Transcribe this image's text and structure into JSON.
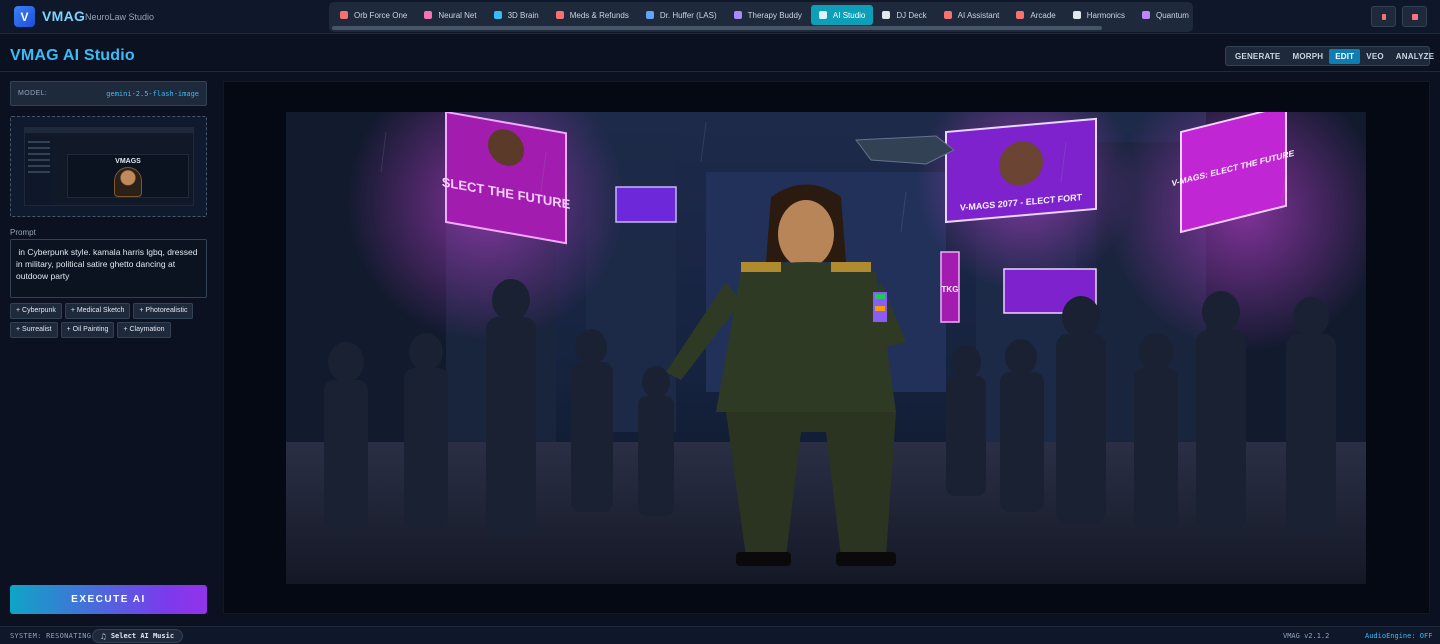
{
  "app": {
    "logo_letter": "V",
    "name": "VMAG",
    "subtitle": "NeuroLaw Studio"
  },
  "nav": {
    "items": [
      {
        "label": "Orb Force One",
        "icon": "orb-icon",
        "color": "#f87171"
      },
      {
        "label": "Neural Net",
        "icon": "brain-icon",
        "color": "#f472b6"
      },
      {
        "label": "3D Brain",
        "icon": "cube-icon",
        "color": "#38bdf8"
      },
      {
        "label": "Meds & Refunds",
        "icon": "pill-icon",
        "color": "#f87171"
      },
      {
        "label": "Dr. Huffer (LAS)",
        "icon": "shield-icon",
        "color": "#60a5fa"
      },
      {
        "label": "Therapy Buddy",
        "icon": "chat-icon",
        "color": "#a78bfa"
      },
      {
        "label": "AI Studio",
        "icon": "palette-icon",
        "color": "#e0f2fe",
        "active": true
      },
      {
        "label": "DJ Deck",
        "icon": "headphones-icon",
        "color": "#e2e8f0"
      },
      {
        "label": "AI Assistant",
        "icon": "robot-icon",
        "color": "#f87171"
      },
      {
        "label": "Arcade",
        "icon": "joystick-icon",
        "color": "#f87171"
      },
      {
        "label": "Harmonics",
        "icon": "chart-icon",
        "color": "#e2e8f0"
      },
      {
        "label": "Quantum",
        "icon": "quantum-icon",
        "color": "#c084fc"
      },
      {
        "label": "",
        "icon": "more-icon",
        "color": "#fbbf24"
      }
    ]
  },
  "toolbar": {
    "icon_left": "mic-icon",
    "icon_right": "profile-icon"
  },
  "page": {
    "title": "VMAG AI Studio"
  },
  "modes": [
    {
      "label": "GENERATE"
    },
    {
      "label": "MORPH"
    },
    {
      "label": "EDIT",
      "active": true
    },
    {
      "label": "VEO"
    },
    {
      "label": "ANALYZE"
    }
  ],
  "model": {
    "label": "MODEL:",
    "value": "gemini-2.5-flash-image"
  },
  "upload": {
    "thumb_title": "VMAGS"
  },
  "prompt": {
    "label": "Prompt",
    "value": " in Cyberpunk style. kamala harris lgbq, dressed in military, political satire ghetto dancing at outdoow party"
  },
  "styles": [
    "+ Cyberpunk",
    "+ Medical Sketch",
    "+ Photorealistic",
    "+ Surrealist",
    "+ Oil Painting",
    "+ Claymation"
  ],
  "execute_label": "EXECUTE AI",
  "art": {
    "billboards": [
      "SLECT THE FUTURE",
      "V-MAGS 2077 - ELECT FORT",
      "V-MAGS: ELECT THE FUTURE",
      "TKG"
    ]
  },
  "footer": {
    "status": "SYSTEM: RESONATING",
    "music_label": "Select AI Music",
    "version": "VMAG v2.1.2",
    "audio": "AudioEngine: OFF"
  }
}
